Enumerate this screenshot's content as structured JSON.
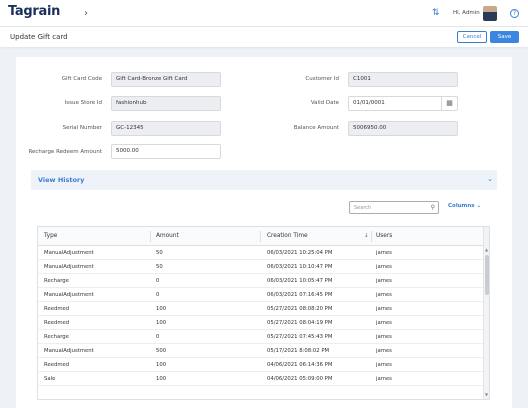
{
  "topbar": {
    "logo_text": "Tagrain",
    "greeting": "Hi, Admin",
    "help_glyph": "?"
  },
  "page": {
    "title": "Update Gift card",
    "cancel_label": "Cancel",
    "save_label": "Save"
  },
  "form": {
    "gift_card_code": {
      "label": "Gift Card Code",
      "value": "Gift Card-Bronze Gift Card"
    },
    "issue_store_id": {
      "label": "Issue Store Id",
      "value": "fashionhub"
    },
    "serial_number": {
      "label": "Serial Number",
      "value": "GC-12345"
    },
    "recharge_redeem_amount": {
      "label": "Recharge Redeem Amount",
      "value": "5000.00"
    },
    "customer_id": {
      "label": "Customer Id",
      "value": "C1001"
    },
    "valid_date": {
      "label": "Valid Date",
      "value": "01/01/0001"
    },
    "balance_amount": {
      "label": "Balance Amount",
      "value": "5006950.00"
    }
  },
  "history": {
    "title": "View History",
    "search_placeholder": "Search",
    "columns_label": "Columns",
    "headers": {
      "type": "Type",
      "amount": "Amount",
      "creation_time": "Creation Time",
      "users": "Users"
    },
    "rows": [
      {
        "type": "ManualAdjustment",
        "amount": "50",
        "time": "06/03/2021 10:25:04 PM",
        "user": "james"
      },
      {
        "type": "ManualAdjustment",
        "amount": "50",
        "time": "06/03/2021 10:10:47 PM",
        "user": "james"
      },
      {
        "type": "Recharge",
        "amount": "0",
        "time": "06/03/2021 10:05:47 PM",
        "user": "james"
      },
      {
        "type": "ManualAdjustment",
        "amount": "0",
        "time": "06/03/2021 07:16:45 PM",
        "user": "james"
      },
      {
        "type": "Reedmed",
        "amount": "100",
        "time": "05/27/2021 08:08:20 PM",
        "user": "james"
      },
      {
        "type": "Reedmed",
        "amount": "100",
        "time": "05/27/2021 08:04:19 PM",
        "user": "james"
      },
      {
        "type": "Recharge",
        "amount": "0",
        "time": "05/27/2021 07:45:43 PM",
        "user": "james"
      },
      {
        "type": "ManualAdjustment",
        "amount": "500",
        "time": "05/17/2021 8:08:02 PM",
        "user": "james"
      },
      {
        "type": "Reedmed",
        "amount": "100",
        "time": "04/06/2021 06:14:36 PM",
        "user": "james"
      },
      {
        "type": "Sale",
        "amount": "100",
        "time": "04/06/2021 05:09:00 PM",
        "user": "james"
      }
    ]
  },
  "colors": {
    "accent": "#3a7bd5",
    "brand_navy": "#1c2e5c",
    "save_bg": "#3a86e0"
  },
  "icons": [
    "logo-ring-icon",
    "chevron-right-icon",
    "sync-icon",
    "avatar",
    "help-icon",
    "calendar-icon",
    "search-icon",
    "chevron-down-icon",
    "sort-down-icon",
    "scroll-up-icon",
    "scroll-down-icon"
  ]
}
